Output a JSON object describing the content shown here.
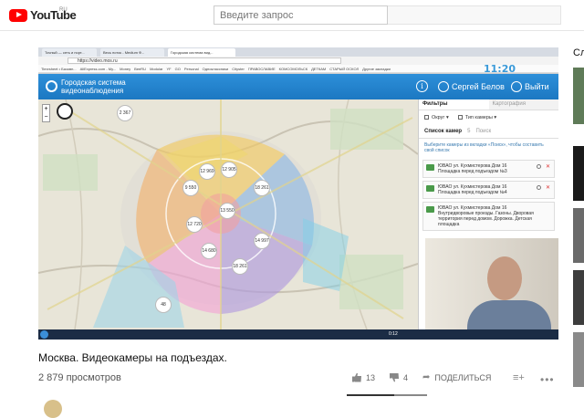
{
  "youtube": {
    "brand": "YouTube",
    "region": "RU",
    "search_placeholder": "Введите запрос"
  },
  "browser": {
    "tabs": [
      "Точный — сеть и порт...",
      "Весь поток - Medium Ф...",
      "Городская система вид..."
    ],
    "url": "https://video.mos.ru",
    "bookmarks": [
      "Timesheet • Базовн...",
      "AliExpress.com - My...",
      "Money",
      "BeeRU",
      "Modular",
      "YF",
      "GO",
      "Personal",
      "Одноклассники",
      "Cityster",
      "ПРАВОСЛАВИЕ",
      "КОМСОМОЛЬСК",
      "ДЕТКАМ",
      "СТАРЫЙ ОСКОЛ",
      "Другие закладки"
    ],
    "clock": "11:20"
  },
  "site": {
    "title_line1": "Городская система",
    "title_line2": "видеонаблюдения",
    "user": "Сергей Белов",
    "exit": "Выйти",
    "info": "i"
  },
  "map": {
    "zoom_in": "+",
    "zoom_out": "−",
    "clusters": [
      {
        "label": "2 367"
      },
      {
        "label": "12 969"
      },
      {
        "label": "12 905"
      },
      {
        "label": "9 550"
      },
      {
        "label": "12 720"
      },
      {
        "label": "13 550"
      },
      {
        "label": "18 261"
      },
      {
        "label": "14 680"
      },
      {
        "label": "14 997"
      },
      {
        "label": "18 261"
      },
      {
        "label": "48"
      }
    ]
  },
  "panel": {
    "tab_filters": "Фильтры",
    "tab_cartography": "Картография",
    "filter_district": "Округ",
    "filter_camera_type": "Тип камеры",
    "tab_camera_list": "Список камер",
    "tab_camera_list_count": "5",
    "tab_search": "Поиск",
    "hint": "Выберите камеры из вкладки «Поиск», чтобы составить свой список",
    "cameras": [
      {
        "name": "ЮВАО ул. Кухмистерова Дом 16",
        "desc": "Площадка перед подъездом №3"
      },
      {
        "name": "ЮВАО ул. Кухмистерова Дом 16",
        "desc": "Площадка перед подъездом №4"
      },
      {
        "name": "ЮВАО ул. Кухмистерова Дом 16",
        "desc": "Внутридворовые проезды. Газоны. Дворовая территория перед домом. Дорожка. Детская площадка"
      }
    ]
  },
  "taskbar": {
    "time": "0:12"
  },
  "video": {
    "title": "Москва. Видеокамеры на подъездах.",
    "views": "2 879 просмотров",
    "likes": "13",
    "dislikes": "4",
    "share": "ПОДЕЛИТЬСЯ",
    "more": "•••",
    "add": "≡+"
  },
  "sidebar": {
    "label": "Сл"
  },
  "colors": {
    "yt_red": "#ff0000",
    "site_blue": "#1c78c2",
    "taskbar": "#1b2c45"
  }
}
